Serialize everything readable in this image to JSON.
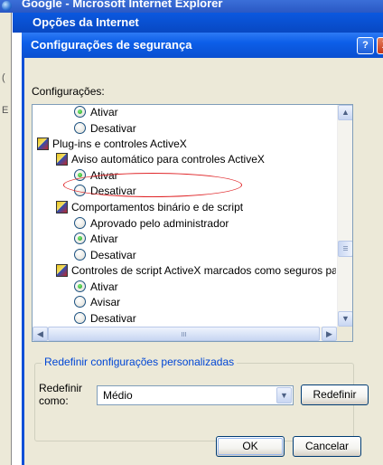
{
  "ie_window": {
    "title": "Google - Microsoft Internet Explorer",
    "left_fragments": [
      "(",
      "E"
    ]
  },
  "options_dialog": {
    "title": "Opções da Internet"
  },
  "dialog": {
    "title": "Configurações de segurança",
    "help_label": "?",
    "close_label": "X",
    "settings_label": "Configurações:",
    "tree": [
      {
        "kind": "radio",
        "label": "Ativar",
        "checked": true
      },
      {
        "kind": "radio",
        "label": "Desativar",
        "checked": false
      },
      {
        "kind": "category",
        "label": "Plug-ins e controles ActiveX"
      },
      {
        "kind": "category",
        "label": "Aviso automático para controles ActiveX"
      },
      {
        "kind": "radio",
        "label": "Ativar",
        "checked": true
      },
      {
        "kind": "radio",
        "label": "Desativar",
        "checked": false
      },
      {
        "kind": "category",
        "label": "Comportamentos binário e de script"
      },
      {
        "kind": "radio",
        "label": "Aprovado pelo administrador",
        "checked": false
      },
      {
        "kind": "radio",
        "label": "Ativar",
        "checked": true
      },
      {
        "kind": "radio",
        "label": "Desativar",
        "checked": false
      },
      {
        "kind": "category",
        "label": "Controles de script ActiveX marcados como seguros pa"
      },
      {
        "kind": "radio",
        "label": "Ativar",
        "checked": true
      },
      {
        "kind": "radio",
        "label": "Avisar",
        "checked": false
      },
      {
        "kind": "radio",
        "label": "Desativar",
        "checked": false
      }
    ],
    "reset_group": {
      "legend": "Redefinir configurações personalizadas",
      "reset_to_label": "Redefinir como:",
      "selected_value": "Médio",
      "reset_button": "Redefinir"
    },
    "ok_button": "OK",
    "cancel_button": "Cancelar",
    "highlight_color": "#e0272a"
  }
}
